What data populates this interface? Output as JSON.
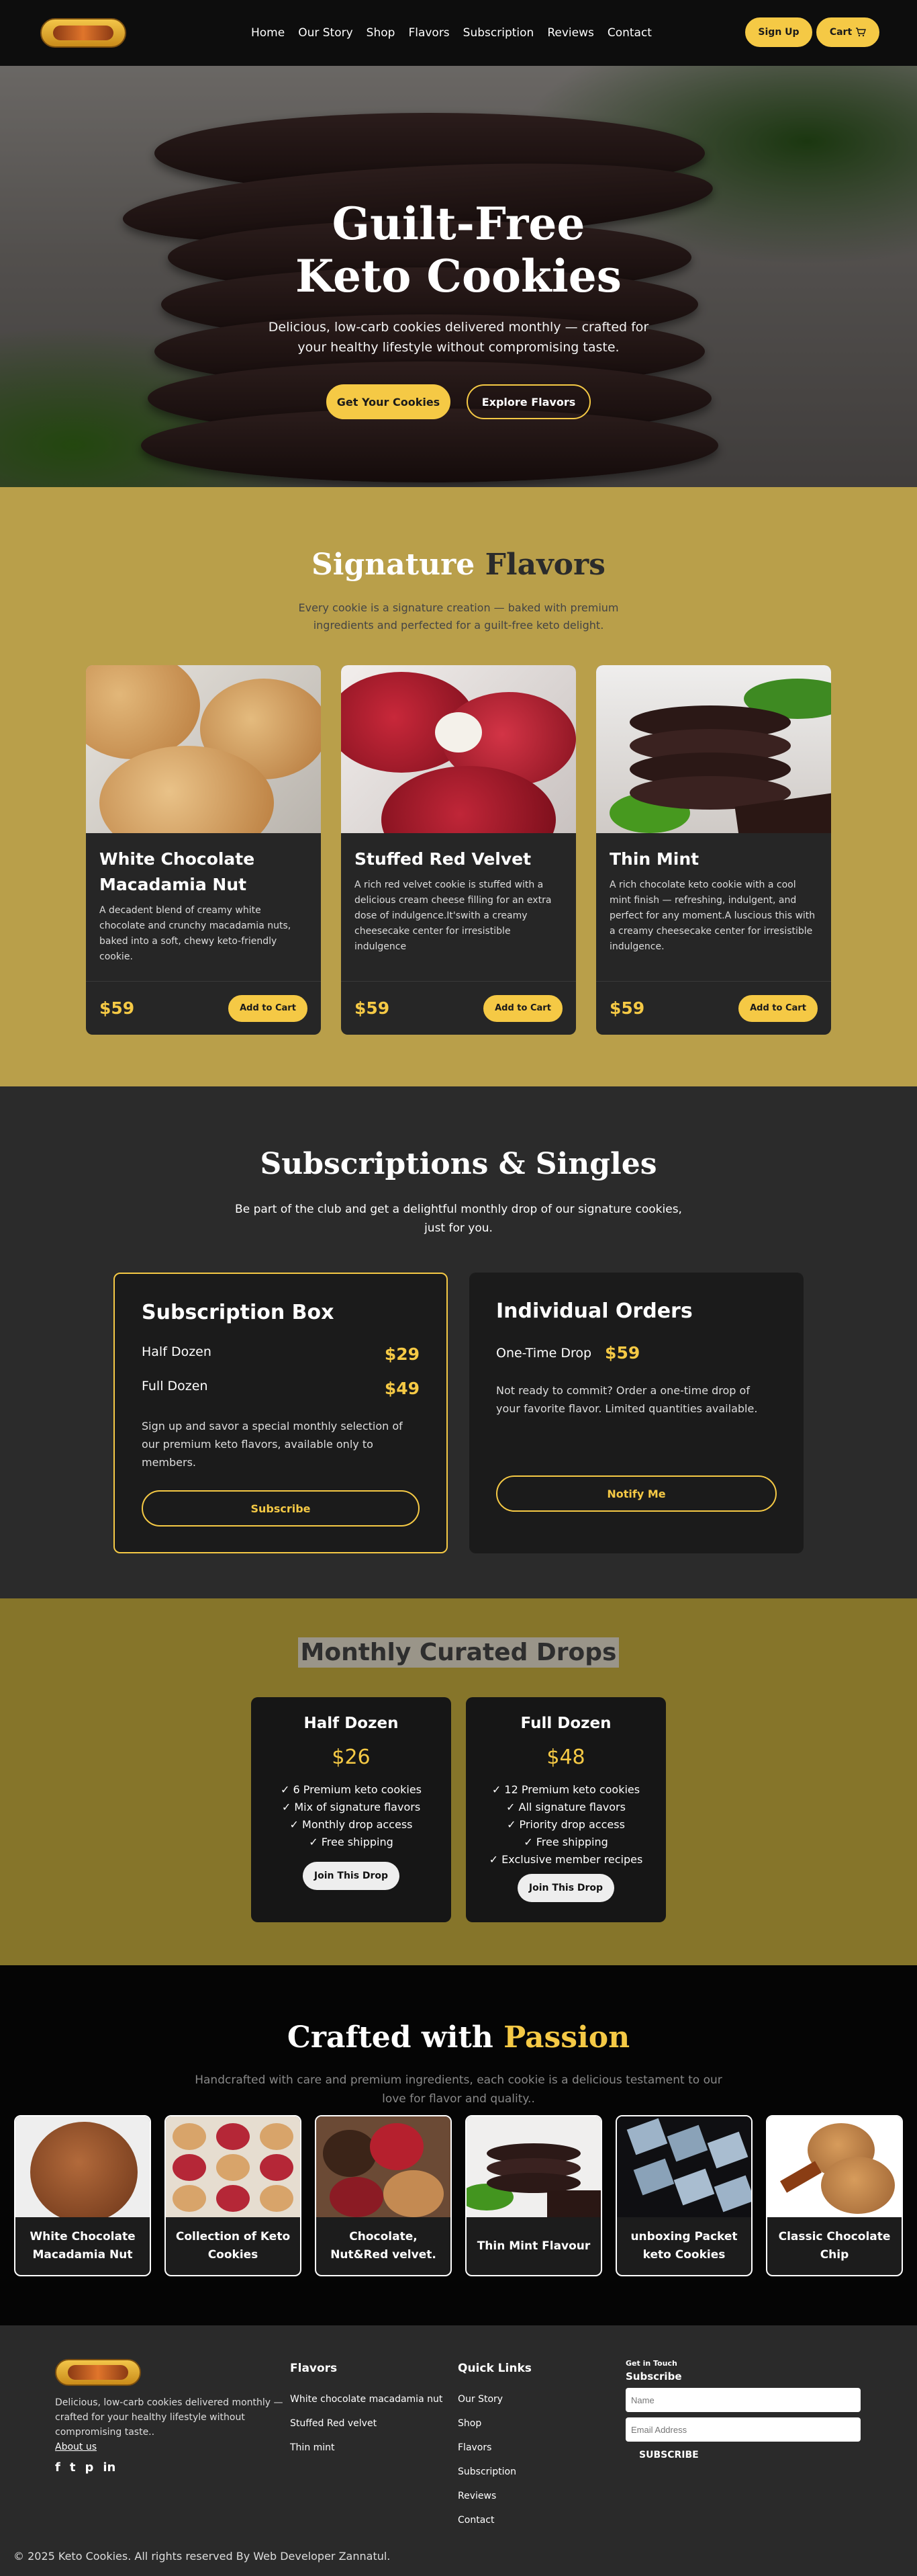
{
  "nav": {
    "links": [
      "Home",
      "Our Story",
      "Shop",
      "Flavors",
      "Subscription",
      "Reviews",
      "Contact"
    ],
    "signup": "Sign Up",
    "cart": "Cart",
    "cart_icon": "shopping-cart-icon"
  },
  "hero": {
    "title_line1": "Guilt-Free",
    "title_line2": "Keto Cookies",
    "subtitle": "Delicious, low-carb cookies delivered monthly — crafted for your healthy lifestyle without compromising taste.",
    "primary_btn": "Get Your Cookies",
    "secondary_btn": "Explore Flavors"
  },
  "signature": {
    "title_a": "Signature",
    "title_b": "Flavors",
    "subtitle": "Every cookie is a signature creation — baked with premium ingredients and perfected for a guilt-free keto delight.",
    "cards": [
      {
        "name": "White Chocolate Macadamia Nut",
        "desc": "A decadent blend of creamy white chocolate and crunchy macadamia nuts, baked into a soft, chewy keto-friendly cookie.",
        "price": "$59",
        "btn": "Add to Cart"
      },
      {
        "name": "Stuffed Red Velvet",
        "desc": "A rich red velvet cookie is stuffed with a delicious cream cheese filling for an extra dose of indulgence.It'swith a creamy cheesecake center for irresistible indulgence",
        "price": "$59",
        "btn": "Add to Cart"
      },
      {
        "name": "Thin Mint",
        "desc": "A rich chocolate keto cookie with a cool mint finish — refreshing, indulgent, and perfect for any moment.A luscious this with a creamy cheesecake center for irresistible indulgence.",
        "price": "$59",
        "btn": "Add to Cart"
      }
    ]
  },
  "subscriptions": {
    "title": "Subscriptions & Singles",
    "subtitle": "Be part of the club and get a delightful monthly drop of our signature cookies, just for you.",
    "box1": {
      "title": "Subscription Box",
      "rows": [
        {
          "label": "Half Dozen",
          "price": "$29"
        },
        {
          "label": "Full Dozen",
          "price": "$49"
        }
      ],
      "text": "Sign up and savor a special monthly selection of our premium keto flavors, available only to members.",
      "btn": "Subscribe"
    },
    "box2": {
      "title": "Individual Orders",
      "label": "One-Time Drop",
      "price": "$59",
      "text": "Not ready to commit? Order a one-time drop of your favorite flavor. Limited quantities available.",
      "btn": "Notify Me"
    }
  },
  "drops": {
    "title": "Monthly Curated Drops",
    "cards": [
      {
        "name": "Half Dozen",
        "price": "$26",
        "features": [
          "✓ 6 Premium keto cookies",
          "✓ Mix of signature flavors",
          "✓ Monthly drop access",
          "✓ Free shipping"
        ],
        "btn": "Join This Drop"
      },
      {
        "name": "Full Dozen",
        "price": "$48",
        "features": [
          "✓ 12 Premium keto cookies",
          "✓ All signature flavors",
          "✓ Priority drop access",
          "✓ Free shipping",
          "✓ Exclusive member recipes"
        ],
        "btn": "Join This Drop"
      }
    ]
  },
  "crafted": {
    "title_a": "Crafted with",
    "title_b": "Passion",
    "subtitle": "Handcrafted with care and premium ingredients, each cookie is a delicious testament to our love for flavor and quality..",
    "items": [
      "White Chocolate Macadamia Nut",
      "Collection of Keto Cookies",
      "Chocolate, Nut&Red velvet.",
      "Thin Mint Flavour",
      "unboxing Packet keto Cookies",
      "Classic Chocolate Chip"
    ]
  },
  "footer": {
    "about": "Delicious, low-carb cookies delivered monthly — crafted for your healthy lifestyle without compromising taste..",
    "about_link": "About us",
    "socials": [
      "f",
      "t",
      "p",
      "in"
    ],
    "flavors_title": "Flavors",
    "flavors": [
      "White chocolate macadamia nut",
      "Stuffed Red velvet",
      "Thin mint"
    ],
    "links_title": "Quick Links",
    "links": [
      "Our Story",
      "Shop",
      "Flavors",
      "Subscription",
      "Reviews",
      "Contact"
    ],
    "touch_label": "Get in Touch",
    "subscribe_title": "Subscribe",
    "name_placeholder": "Name",
    "email_placeholder": "Email Address",
    "subscribe_btn": "SUBSCRIBE",
    "copyright": "© 2025 Keto Cookies. All rights reserved By Web Developer Zannatul."
  },
  "colors": {
    "accent": "#f5c945",
    "signature_bg": "#b99f4a",
    "drops_bg": "#86752a",
    "dark": "#2b2b2b"
  }
}
